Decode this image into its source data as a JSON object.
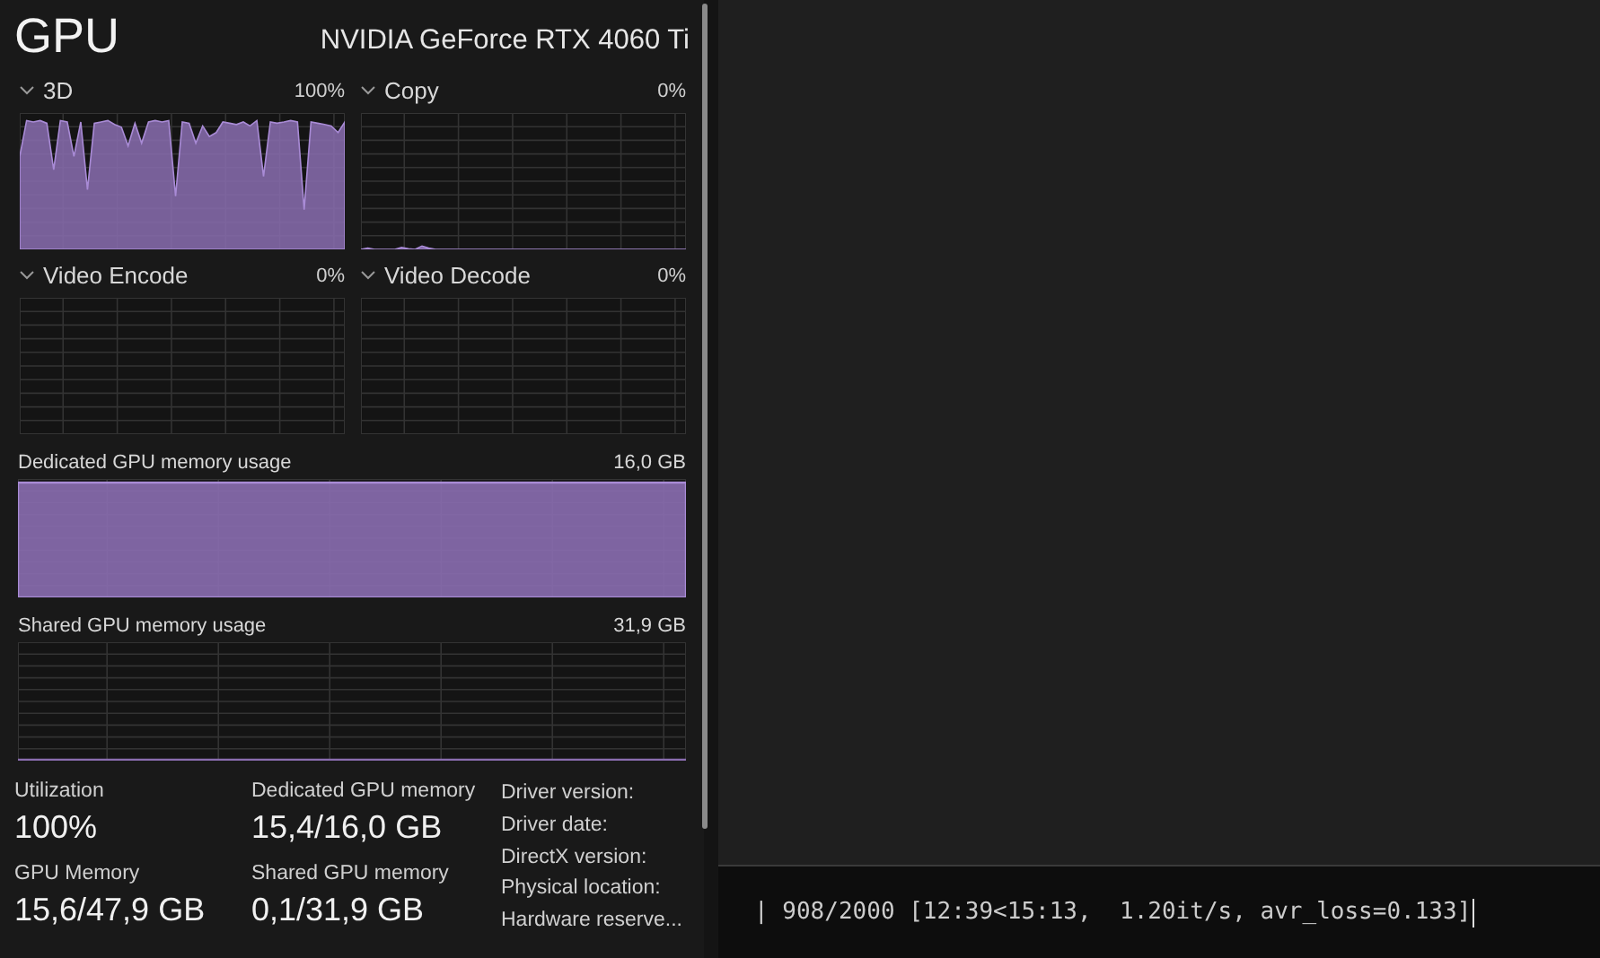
{
  "header": {
    "title": "GPU",
    "adapter": "NVIDIA GeForce RTX 4060 Ti"
  },
  "engines": [
    {
      "name": "3D",
      "value": "100%",
      "kind": "busy"
    },
    {
      "name": "Copy",
      "value": "0%",
      "kind": "blip"
    },
    {
      "name": "Video Encode",
      "value": "0%",
      "kind": "idle"
    },
    {
      "name": "Video Decode",
      "value": "0%",
      "kind": "idle"
    }
  ],
  "memory_graphs": [
    {
      "label": "Dedicated GPU memory usage",
      "capacity": "16,0 GB",
      "kind": "full"
    },
    {
      "label": "Shared GPU memory usage",
      "capacity": "31,9 GB",
      "kind": "empty"
    }
  ],
  "stats": [
    {
      "label": "Utilization",
      "value": "100%"
    },
    {
      "label": "Dedicated GPU memory",
      "value": "15,4/16,0 GB"
    },
    {
      "label": "GPU Memory",
      "value": "15,6/47,9 GB"
    },
    {
      "label": "Shared GPU memory",
      "value": "0,1/31,9 GB"
    }
  ],
  "details": [
    "Driver version:",
    "Driver date:",
    "DirectX version:",
    "Physical location:",
    "Hardware reserve..."
  ],
  "terminal": {
    "line": "| 908/2000 [12:39<15:13,  1.20it/s, avr_loss=0.133]"
  }
}
